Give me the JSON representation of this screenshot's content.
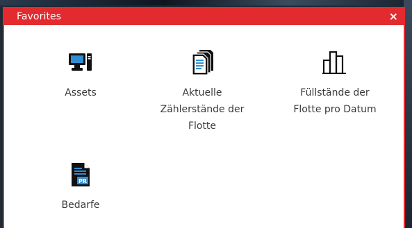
{
  "window": {
    "title": "Favorites",
    "close_symbol": "×"
  },
  "favorites": [
    {
      "label": "Assets",
      "icon": "computer-icon"
    },
    {
      "label": "Aktuelle\nZählerstände der\nFlotte",
      "icon": "documents-icon"
    },
    {
      "label": "Füllstände der\nFlotte pro Datum",
      "icon": "bar-chart-icon"
    },
    {
      "label": "Bedarfe",
      "icon": "pr-document-icon"
    }
  ],
  "colors": {
    "accent": "#e32b2f",
    "icon_dark": "#111111",
    "icon_blue": "#2f8ed3"
  }
}
